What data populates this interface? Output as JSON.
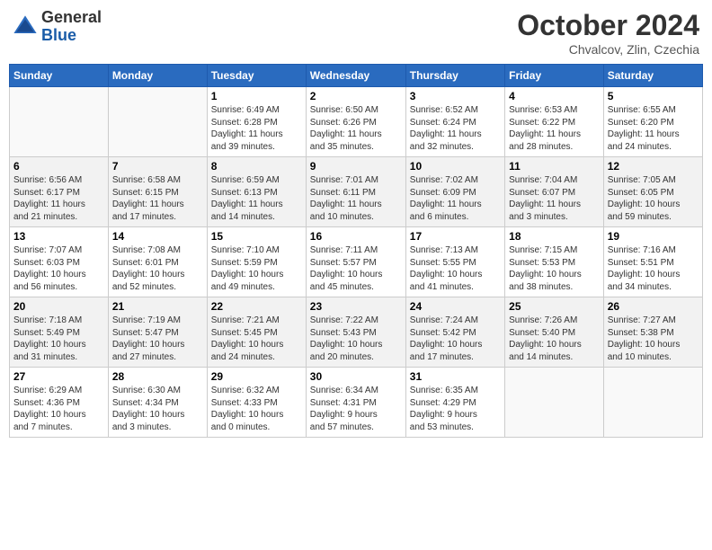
{
  "header": {
    "logo_general": "General",
    "logo_blue": "Blue",
    "month_title": "October 2024",
    "location": "Chvalcov, Zlin, Czechia"
  },
  "columns": [
    "Sunday",
    "Monday",
    "Tuesday",
    "Wednesday",
    "Thursday",
    "Friday",
    "Saturday"
  ],
  "weeks": [
    [
      {
        "num": "",
        "info": ""
      },
      {
        "num": "",
        "info": ""
      },
      {
        "num": "1",
        "info": "Sunrise: 6:49 AM\nSunset: 6:28 PM\nDaylight: 11 hours\nand 39 minutes."
      },
      {
        "num": "2",
        "info": "Sunrise: 6:50 AM\nSunset: 6:26 PM\nDaylight: 11 hours\nand 35 minutes."
      },
      {
        "num": "3",
        "info": "Sunrise: 6:52 AM\nSunset: 6:24 PM\nDaylight: 11 hours\nand 32 minutes."
      },
      {
        "num": "4",
        "info": "Sunrise: 6:53 AM\nSunset: 6:22 PM\nDaylight: 11 hours\nand 28 minutes."
      },
      {
        "num": "5",
        "info": "Sunrise: 6:55 AM\nSunset: 6:20 PM\nDaylight: 11 hours\nand 24 minutes."
      }
    ],
    [
      {
        "num": "6",
        "info": "Sunrise: 6:56 AM\nSunset: 6:17 PM\nDaylight: 11 hours\nand 21 minutes."
      },
      {
        "num": "7",
        "info": "Sunrise: 6:58 AM\nSunset: 6:15 PM\nDaylight: 11 hours\nand 17 minutes."
      },
      {
        "num": "8",
        "info": "Sunrise: 6:59 AM\nSunset: 6:13 PM\nDaylight: 11 hours\nand 14 minutes."
      },
      {
        "num": "9",
        "info": "Sunrise: 7:01 AM\nSunset: 6:11 PM\nDaylight: 11 hours\nand 10 minutes."
      },
      {
        "num": "10",
        "info": "Sunrise: 7:02 AM\nSunset: 6:09 PM\nDaylight: 11 hours\nand 6 minutes."
      },
      {
        "num": "11",
        "info": "Sunrise: 7:04 AM\nSunset: 6:07 PM\nDaylight: 11 hours\nand 3 minutes."
      },
      {
        "num": "12",
        "info": "Sunrise: 7:05 AM\nSunset: 6:05 PM\nDaylight: 10 hours\nand 59 minutes."
      }
    ],
    [
      {
        "num": "13",
        "info": "Sunrise: 7:07 AM\nSunset: 6:03 PM\nDaylight: 10 hours\nand 56 minutes."
      },
      {
        "num": "14",
        "info": "Sunrise: 7:08 AM\nSunset: 6:01 PM\nDaylight: 10 hours\nand 52 minutes."
      },
      {
        "num": "15",
        "info": "Sunrise: 7:10 AM\nSunset: 5:59 PM\nDaylight: 10 hours\nand 49 minutes."
      },
      {
        "num": "16",
        "info": "Sunrise: 7:11 AM\nSunset: 5:57 PM\nDaylight: 10 hours\nand 45 minutes."
      },
      {
        "num": "17",
        "info": "Sunrise: 7:13 AM\nSunset: 5:55 PM\nDaylight: 10 hours\nand 41 minutes."
      },
      {
        "num": "18",
        "info": "Sunrise: 7:15 AM\nSunset: 5:53 PM\nDaylight: 10 hours\nand 38 minutes."
      },
      {
        "num": "19",
        "info": "Sunrise: 7:16 AM\nSunset: 5:51 PM\nDaylight: 10 hours\nand 34 minutes."
      }
    ],
    [
      {
        "num": "20",
        "info": "Sunrise: 7:18 AM\nSunset: 5:49 PM\nDaylight: 10 hours\nand 31 minutes."
      },
      {
        "num": "21",
        "info": "Sunrise: 7:19 AM\nSunset: 5:47 PM\nDaylight: 10 hours\nand 27 minutes."
      },
      {
        "num": "22",
        "info": "Sunrise: 7:21 AM\nSunset: 5:45 PM\nDaylight: 10 hours\nand 24 minutes."
      },
      {
        "num": "23",
        "info": "Sunrise: 7:22 AM\nSunset: 5:43 PM\nDaylight: 10 hours\nand 20 minutes."
      },
      {
        "num": "24",
        "info": "Sunrise: 7:24 AM\nSunset: 5:42 PM\nDaylight: 10 hours\nand 17 minutes."
      },
      {
        "num": "25",
        "info": "Sunrise: 7:26 AM\nSunset: 5:40 PM\nDaylight: 10 hours\nand 14 minutes."
      },
      {
        "num": "26",
        "info": "Sunrise: 7:27 AM\nSunset: 5:38 PM\nDaylight: 10 hours\nand 10 minutes."
      }
    ],
    [
      {
        "num": "27",
        "info": "Sunrise: 6:29 AM\nSunset: 4:36 PM\nDaylight: 10 hours\nand 7 minutes."
      },
      {
        "num": "28",
        "info": "Sunrise: 6:30 AM\nSunset: 4:34 PM\nDaylight: 10 hours\nand 3 minutes."
      },
      {
        "num": "29",
        "info": "Sunrise: 6:32 AM\nSunset: 4:33 PM\nDaylight: 10 hours\nand 0 minutes."
      },
      {
        "num": "30",
        "info": "Sunrise: 6:34 AM\nSunset: 4:31 PM\nDaylight: 9 hours\nand 57 minutes."
      },
      {
        "num": "31",
        "info": "Sunrise: 6:35 AM\nSunset: 4:29 PM\nDaylight: 9 hours\nand 53 minutes."
      },
      {
        "num": "",
        "info": ""
      },
      {
        "num": "",
        "info": ""
      }
    ]
  ]
}
